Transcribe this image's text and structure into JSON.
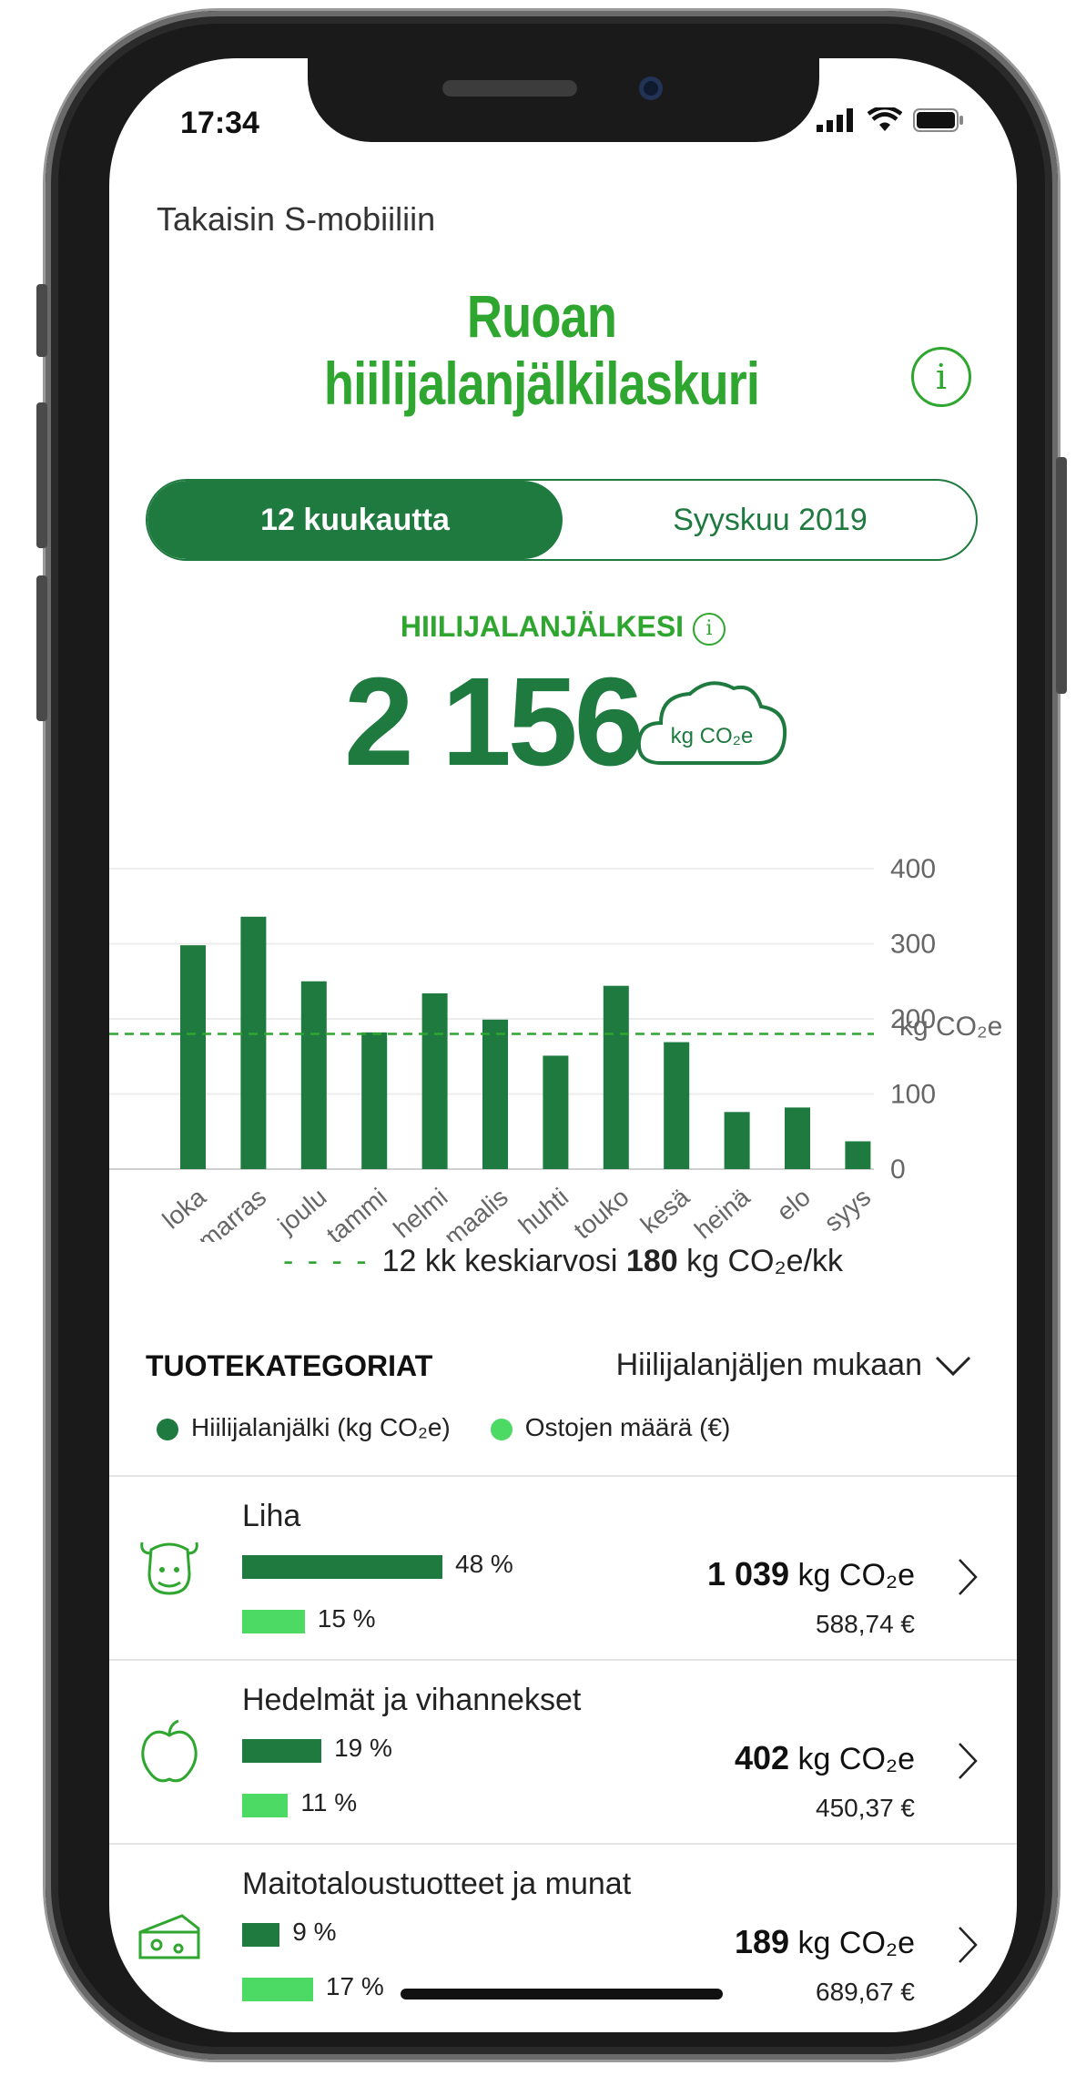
{
  "status_bar": {
    "time": "17:34"
  },
  "nav": {
    "back_label": "Takaisin S-mobiiliin"
  },
  "header": {
    "title_line1": "Ruoan",
    "title_line2": "hiilijalanjälkilaskuri",
    "info_glyph": "i"
  },
  "period_tabs": [
    {
      "label": "12 kuukautta",
      "selected": true
    },
    {
      "label": "Syyskuu 2019",
      "selected": false
    }
  ],
  "footprint": {
    "label": "HIILIJALANJÄLKESI",
    "value": "2 156",
    "unit": "kg CO₂e"
  },
  "chart_data": {
    "type": "bar",
    "categories": [
      "loka",
      "marras",
      "joulu",
      "tammi",
      "helmi",
      "maalis",
      "huhti",
      "touko",
      "kesä",
      "heinä",
      "elo",
      "syys"
    ],
    "values": [
      298,
      336,
      250,
      182,
      234,
      199,
      151,
      244,
      169,
      76,
      82,
      37
    ],
    "ylim": [
      0,
      400
    ],
    "yticks": [
      "400",
      "300",
      "200",
      "100",
      "0"
    ],
    "ylabel": "kg CO₂e",
    "average": 180,
    "grid": true,
    "bar_color": "#1e7a3e",
    "avg_color": "#2fa62f"
  },
  "average_legend": {
    "prefix": "12 kk keskiarvosi",
    "value": "180",
    "unit": "kg CO₂e/kk"
  },
  "categories_section": {
    "title": "TUOTEKATEGORIAT",
    "sort_label": "Hiilijalanjäljen mukaan",
    "legend_footprint": "Hiilijalanjälki (kg CO₂e)",
    "legend_purchases": "Ostojen määrä (€)",
    "items": [
      {
        "name": "Liha",
        "footprint_pct": 48,
        "footprint_pct_label": "48 %",
        "purchase_pct": 15,
        "purchase_pct_label": "15 %",
        "kg": "1 039",
        "kg_unit": "kg CO₂e",
        "eur": "588,74 €",
        "icon": "cow-icon"
      },
      {
        "name": "Hedelmät ja vihannekset",
        "footprint_pct": 19,
        "footprint_pct_label": "19 %",
        "purchase_pct": 11,
        "purchase_pct_label": "11 %",
        "kg": "402",
        "kg_unit": "kg CO₂e",
        "eur": "450,37 €",
        "icon": "apple-icon"
      },
      {
        "name": "Maitotaloustuotteet ja munat",
        "footprint_pct": 9,
        "footprint_pct_label": "9 %",
        "purchase_pct": 17,
        "purchase_pct_label": "17 %",
        "kg": "189",
        "kg_unit": "kg CO₂e",
        "eur": "689,67 €",
        "icon": "cheese-icon"
      }
    ]
  },
  "colors": {
    "brand_green": "#2fa62f",
    "dark_green": "#1e7a3e",
    "light_green": "#4cd964"
  }
}
